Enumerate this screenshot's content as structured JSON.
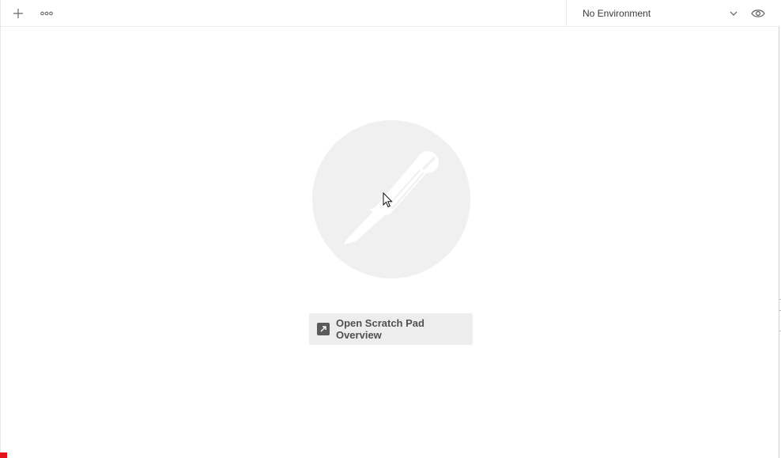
{
  "tabbar": {
    "new_tab_icon": "plus-icon",
    "more_icon": "more-horizontal-icon"
  },
  "environment": {
    "selected": "No Environment",
    "dropdown_icon": "chevron-down-icon",
    "quick_look_icon": "eye-icon"
  },
  "empty_state": {
    "logo": "postman-logo",
    "button_label": "Open Scratch Pad Overview",
    "button_icon": "external-link-icon"
  },
  "colors": {
    "logo_bg": "#f0f0f0",
    "button_bg": "#ededed",
    "marker": "#e4101c"
  }
}
